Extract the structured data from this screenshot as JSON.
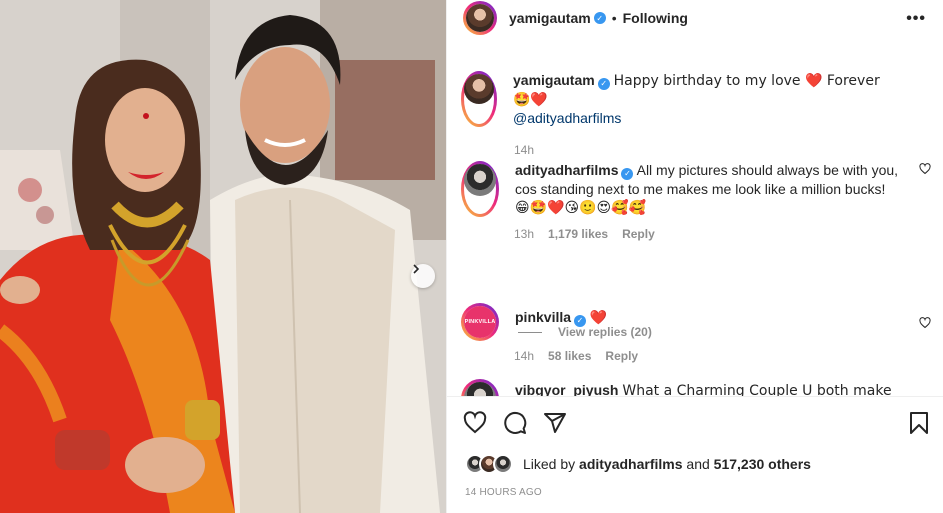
{
  "post": {
    "author": "yamigautam",
    "follow_status": "Following",
    "more_icon": "more-horizontal-icon"
  },
  "caption": {
    "username": "yamigautam",
    "text": "Happy birthday to my love ❤️ Forever 🤩❤️",
    "mention": "@adityadharfilms",
    "time": "14h"
  },
  "comments": [
    {
      "username": "adityadharfilms",
      "text": "All my pictures should always be with you, cos standing next to me makes me look like a million bucks!",
      "emojis": "😁🤩❤️😘🙂😍🥰🥰",
      "time": "13h",
      "likes": "1,179 likes",
      "reply": "Reply",
      "view_replies": "View replies (20)"
    },
    {
      "username": "pinkvilla",
      "avatar_text": "PINKVILLA",
      "text": "❤️",
      "time": "14h",
      "likes": "58 likes",
      "reply": "Reply"
    },
    {
      "username": "vibgyor_piyush",
      "text": "What a Charming Couple U both make ❤️"
    }
  ],
  "likes_line": {
    "prefix": "Liked by",
    "user": "adityadharfilms",
    "middle": "and",
    "count": "517,230 others"
  },
  "timestamp": "14 HOURS AGO",
  "colors": {
    "verified": "#3897f0",
    "meta_gray": "#8e8e8e",
    "saree_red": "#e0301e",
    "pinkvilla": "#e8336b"
  }
}
